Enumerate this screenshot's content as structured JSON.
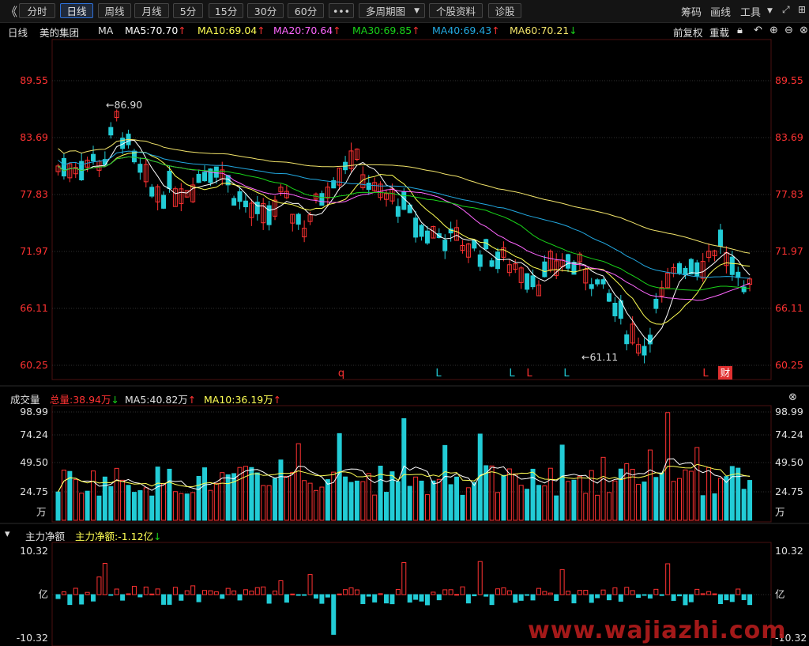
{
  "toolbar": {
    "back_label": "《",
    "periods": [
      "分时",
      "日线",
      "周线",
      "月线",
      "5分",
      "15分",
      "30分",
      "60分"
    ],
    "active_period": "日线",
    "more_label": "•••",
    "multi_period_label": "多周期图",
    "stock_data_label": "个股资料",
    "diagnose_label": "诊股",
    "chips_label": "筹码",
    "draw_label": "画线",
    "tools_label": "工具"
  },
  "kline": {
    "period_label": "日线",
    "stock_name": "美的集团",
    "indicator": "MA",
    "ma": [
      {
        "label": "MA5:70.70",
        "dir": "up",
        "color": "#ffffff"
      },
      {
        "label": "MA10:69.04",
        "dir": "up",
        "color": "#ffff54"
      },
      {
        "label": "MA20:70.64",
        "dir": "up",
        "color": "#ff66ff"
      },
      {
        "label": "MA30:69.85",
        "dir": "up",
        "color": "#19d219"
      },
      {
        "label": "MA40:69.43",
        "dir": "up",
        "color": "#22a8e0"
      },
      {
        "label": "MA60:70.21",
        "dir": "down",
        "color": "#f2e46a"
      }
    ],
    "adjust_label": "前复权",
    "rights_label": "重载",
    "y_ticks": [
      "89.55",
      "83.69",
      "77.83",
      "71.97",
      "66.11",
      "60.25"
    ],
    "high_label": "←86.90",
    "low_label": "←61.11",
    "markers": [
      "q",
      "L",
      "L",
      "L",
      "L",
      "L",
      "财"
    ]
  },
  "volume": {
    "title": "成交量",
    "total": "总量:38.94万",
    "total_dir": "down",
    "ma5": "MA5:40.82万",
    "ma5_dir": "up",
    "ma10": "MA10:36.19万",
    "ma10_dir": "up",
    "y_ticks": [
      "98.99",
      "74.24",
      "49.50",
      "24.75"
    ],
    "unit": "万"
  },
  "flow": {
    "title": "主力净额",
    "value": "主力净额:-1.12亿",
    "value_dir": "down",
    "y_ticks": [
      "10.32",
      "亿",
      "-10.32"
    ]
  },
  "colors": {
    "up": "#ff3232",
    "down": "#22ccd6",
    "axis": "#ff3232",
    "grid": "#303030"
  },
  "watermark": "www.wajiazhi.com"
}
